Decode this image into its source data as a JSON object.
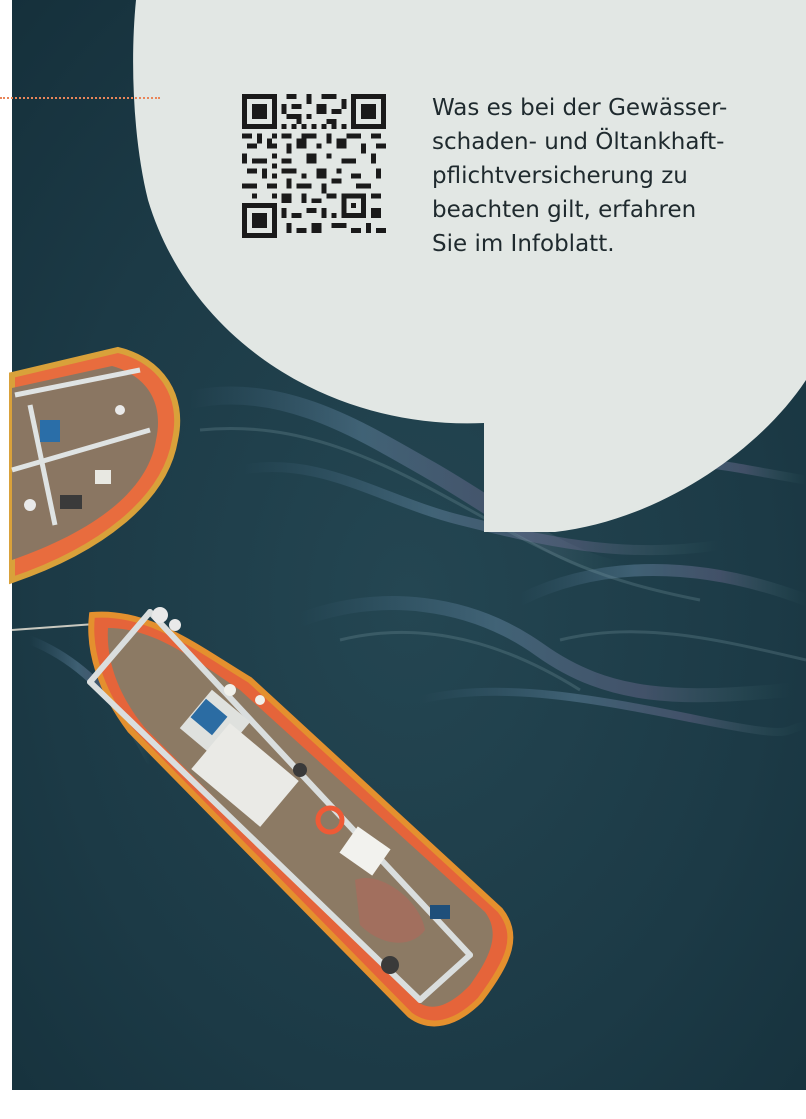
{
  "page": {
    "info_lines": [
      "Was es bei der Gewässer-",
      "schaden- und Öltankhaft-",
      "pflichtversicherung zu",
      "beachten gilt, erfahren",
      "Sie im Infoblatt."
    ]
  },
  "qr_code": {
    "icon": "qr-code-icon"
  },
  "photo": {
    "subject": "aerial-fishing-boats-oil-spill-image"
  },
  "colors": {
    "water": "#1d3a47",
    "bubble": "#e2e7e4",
    "hull_orange": "#e5643a",
    "hull_trim": "#e4902e",
    "deck": "#8c7a64",
    "text": "#1f2a2e",
    "accent_dots": "#e9865a"
  }
}
